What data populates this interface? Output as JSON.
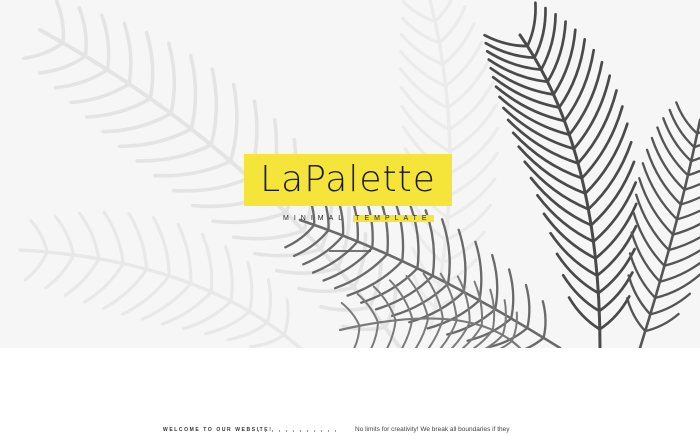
{
  "hero": {
    "logo": "LaPalette",
    "subtitle_a": "MINIMAL",
    "subtitle_b": "TEMPLATE",
    "accent_color": "#f5e53a",
    "background_color": "#f6f6f6"
  },
  "intro": {
    "welcome": "WELCOME TO OUR WEBSITE!",
    "tagline": "No limits for creativity! We break all boundaries if they"
  }
}
